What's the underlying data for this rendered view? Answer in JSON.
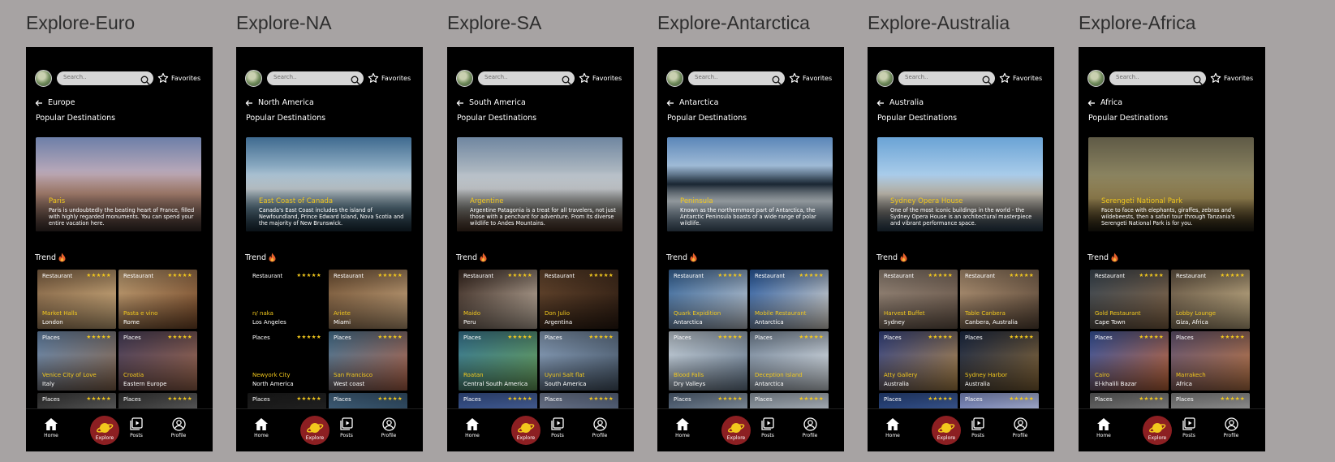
{
  "common": {
    "search_placeholder": "Search..",
    "favorites_label": "Favorites",
    "popular_label": "Popular Destinations",
    "trend_label": "Trend",
    "stars": "★★★★★",
    "nav": {
      "home": "Home",
      "explore": "Explore",
      "posts": "Posts",
      "profile": "Profile"
    },
    "colors": {
      "accent": "#f2c81d",
      "explore_button": "#8c1f22",
      "background": "#a7a3a3"
    }
  },
  "frames": [
    {
      "title": "Explore-Euro",
      "region": "Europe",
      "hero": {
        "title": "Paris",
        "description": "Paris is undoubtedly the beating heart of France, filled with highly regarded monuments. You can spend your entire vacation here."
      },
      "tiles": [
        {
          "category": "Restaurant",
          "name": "Market Halls",
          "location": "London"
        },
        {
          "category": "Restaurant",
          "name": "Pasta e vino",
          "location": "Rome"
        },
        {
          "category": "Places",
          "name": "Venice City of Love",
          "location": "Italy"
        },
        {
          "category": "Places",
          "name": "Croatia",
          "location": "Eastern Europe"
        },
        {
          "category": "Places",
          "name": "",
          "location": ""
        },
        {
          "category": "Places",
          "name": "",
          "location": ""
        }
      ]
    },
    {
      "title": "Explore-NA",
      "region": "North America",
      "hero": {
        "title": "East Coast of Canada",
        "description": "Canada's East Coast includes the island of Newfoundland, Prince Edward Island, Nova Scotia and the majority of New Brunswick."
      },
      "tiles": [
        {
          "category": "Restaurant",
          "name": "n/ naka",
          "location": "Los Angeles"
        },
        {
          "category": "Restaurant",
          "name": "Ariete",
          "location": "Miami"
        },
        {
          "category": "Places",
          "name": "Newyork City",
          "location": "North America"
        },
        {
          "category": "Places",
          "name": "San Francisco",
          "location": "West coast"
        },
        {
          "category": "Places",
          "name": "",
          "location": ""
        },
        {
          "category": "Places",
          "name": "",
          "location": ""
        }
      ]
    },
    {
      "title": "Explore-SA",
      "region": "South America",
      "hero": {
        "title": "Argentine",
        "description": "Argentine Patagonia is a treat for all travelers, not just those with a penchant for adventure. From its diverse wildlife to Andes Mountains."
      },
      "tiles": [
        {
          "category": "Restaurant",
          "name": "Maido",
          "location": "Peru"
        },
        {
          "category": "Restaurant",
          "name": "Don Julio",
          "location": "Argentina"
        },
        {
          "category": "Places",
          "name": "Roatan",
          "location": "Central South America"
        },
        {
          "category": "Places",
          "name": "Uyuni Salt flat",
          "location": "South America"
        },
        {
          "category": "Places",
          "name": "",
          "location": ""
        },
        {
          "category": "Places",
          "name": "",
          "location": ""
        }
      ]
    },
    {
      "title": "Explore-Antarctica",
      "region": "Antarctica",
      "hero": {
        "title": "Peninsula",
        "description": "Known as the northernmost part of Antarctica, the Antarctic Peninsula boasts of a wide range of polar wildlife."
      },
      "tiles": [
        {
          "category": "Restaurant",
          "name": "Quark Expidition",
          "location": "Antarctica"
        },
        {
          "category": "Restaurant",
          "name": "Mobile Restaurant",
          "location": "Antarctica"
        },
        {
          "category": "Places",
          "name": "Blood Falls",
          "location": "Dry Valleys"
        },
        {
          "category": "Places",
          "name": "Deception Island",
          "location": "Antarctica"
        },
        {
          "category": "Places",
          "name": "",
          "location": ""
        },
        {
          "category": "Places",
          "name": "",
          "location": ""
        }
      ]
    },
    {
      "title": "Explore-Australia",
      "region": "Australia",
      "hero": {
        "title": "Sydney Opera House",
        "description": "One of the most iconic buildings in the world - the Sydney Opera House is an architectural masterpiece and vibrant performance space."
      },
      "tiles": [
        {
          "category": "Restaurant",
          "name": "Harvest Buffet",
          "location": "Sydney"
        },
        {
          "category": "Restaurant",
          "name": "Table Canbera",
          "location": "Canbera, Australia"
        },
        {
          "category": "Places",
          "name": "Atty Gallery",
          "location": "Australia"
        },
        {
          "category": "Places",
          "name": "Sydney Harbor",
          "location": "Australia"
        },
        {
          "category": "Places",
          "name": "",
          "location": ""
        },
        {
          "category": "Places",
          "name": "",
          "location": ""
        }
      ]
    },
    {
      "title": "Explore-Africa",
      "region": "Africa",
      "hero": {
        "title": "Serengeti National Park",
        "description": "Face to face with elephants, giraffes, zebras and wildebeests, then a safari tour through Tanzania's Serengeti National Park is for you."
      },
      "tiles": [
        {
          "category": "Restaurant",
          "name": "Gold Restaurant",
          "location": "Cape Town"
        },
        {
          "category": "Restaurant",
          "name": "Lobby Lounge",
          "location": "Giza, Africa"
        },
        {
          "category": "Places",
          "name": "Cairo",
          "location": "El-khalili Bazar"
        },
        {
          "category": "Places",
          "name": "Marrakech",
          "location": "Africa"
        },
        {
          "category": "Places",
          "name": "",
          "location": ""
        },
        {
          "category": "Places",
          "name": "",
          "location": ""
        }
      ]
    }
  ]
}
